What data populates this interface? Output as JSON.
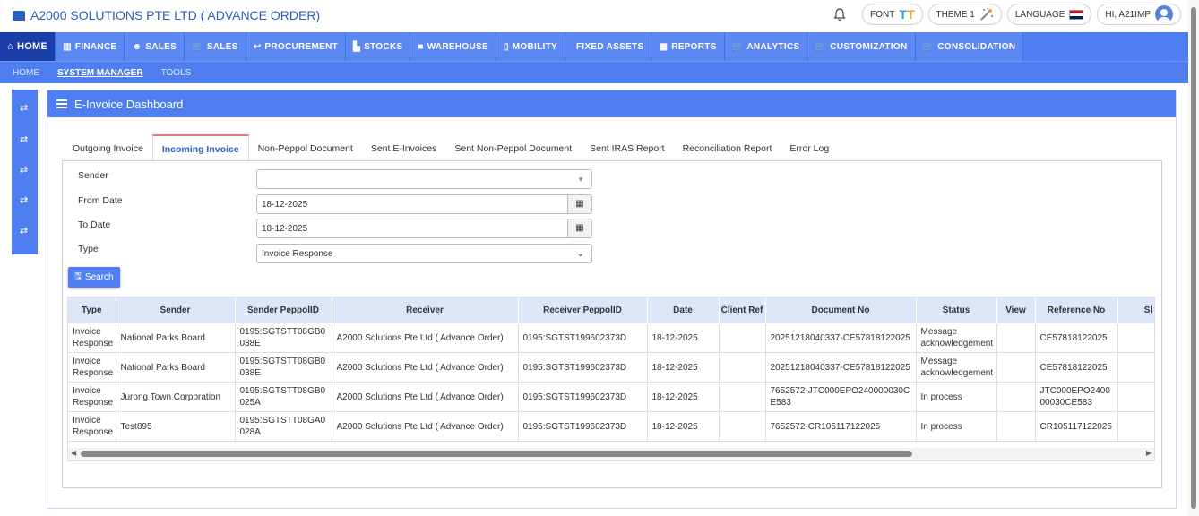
{
  "app": {
    "title": "A2000 SOLUTIONS PTE LTD ( ADVANCE ORDER)"
  },
  "topbar": {
    "font_label": "FONT",
    "font_glyph": "T",
    "font_glyph2": "T",
    "theme_label": "THEME 1",
    "language_label": "LANGUAGE",
    "user_label": "HI, A21IMP",
    "icons": [
      "bell-icon",
      "font-icon",
      "theme-icon",
      "uk-flag-icon",
      "avatar-icon"
    ]
  },
  "nav": {
    "items": [
      {
        "label": "HOME",
        "icon": "⌂"
      },
      {
        "label": "FINANCE",
        "icon": "▥"
      },
      {
        "label": "SALES",
        "icon": "☻"
      },
      {
        "label": "SALES",
        "icon": "🛒"
      },
      {
        "label": "PROCUREMENT",
        "icon": "↩"
      },
      {
        "label": "STOCKS",
        "icon": "▙"
      },
      {
        "label": "WAREHOUSE",
        "icon": "■"
      },
      {
        "label": "MOBILITY",
        "icon": "▯"
      },
      {
        "label": "FIXED ASSETS",
        "icon": ""
      },
      {
        "label": "REPORTS",
        "icon": "▦"
      },
      {
        "label": "ANALYTICS",
        "icon": "🛒"
      },
      {
        "label": "CUSTOMIZATION",
        "icon": "🛒"
      },
      {
        "label": "CONSOLIDATION",
        "icon": "🛒"
      }
    ]
  },
  "subnav": {
    "items": [
      "HOME",
      "SYSTEM MANAGER",
      "TOOLS"
    ]
  },
  "sidebar": {
    "icon": "⇄"
  },
  "panel": {
    "title": "E-Invoice Dashboard",
    "tabs": [
      "Outgoing Invoice",
      "Incoming Invoice",
      "Non-Peppol Document",
      "Sent E-Invoices",
      "Sent Non-Peppol Document",
      "Sent IRAS Report",
      "Reconciliation Report",
      "Error Log"
    ]
  },
  "form": {
    "sender_label": "Sender",
    "sender_value": "",
    "from_label": "From Date",
    "from_value": "18-12-2025",
    "to_label": "To Date",
    "to_value": "18-12-2025",
    "type_label": "Type",
    "type_value": "Invoice Response",
    "search_label": "Search"
  },
  "table": {
    "columns": [
      "Type",
      "Sender",
      "Sender PeppolID",
      "Receiver",
      "Receiver PeppolID",
      "Date",
      "Client Ref",
      "Document No",
      "Status",
      "View",
      "Reference No",
      "Sl"
    ],
    "rows": [
      [
        "Invoice Response",
        "National Parks Board",
        "0195:SGTSTT08GB0038E",
        "A2000 Solutions Pte Ltd ( Advance Order)",
        "0195:SGTST199602373D",
        "18-12-2025",
        "",
        "20251218040337-CE57818122025",
        "Message acknowledgement",
        "",
        "CE57818122025",
        ""
      ],
      [
        "Invoice Response",
        "National Parks Board",
        "0195:SGTSTT08GB0038E",
        "A2000 Solutions Pte Ltd ( Advance Order)",
        "0195:SGTST199602373D",
        "18-12-2025",
        "",
        "20251218040337-CE57818122025",
        "Message acknowledgement",
        "",
        "CE57818122025",
        ""
      ],
      [
        "Invoice Response",
        "Jurong Town Corporation",
        "0195:SGTSTT08GB0025A",
        "A2000 Solutions Pte Ltd ( Advance Order)",
        "0195:SGTST199602373D",
        "18-12-2025",
        "",
        "7652572-JTC000EPO240000030CE583",
        "In process",
        "",
        "JTC000EPO240000030CE583",
        ""
      ],
      [
        "Invoice Response",
        "Test895",
        "0195:SGTSTT08GA0028A",
        "A2000 Solutions Pte Ltd ( Advance Order)",
        "0195:SGTST199602373D",
        "18-12-2025",
        "",
        "7652572-CR105117122025",
        "In process",
        "",
        "CR105117122025",
        ""
      ]
    ]
  }
}
